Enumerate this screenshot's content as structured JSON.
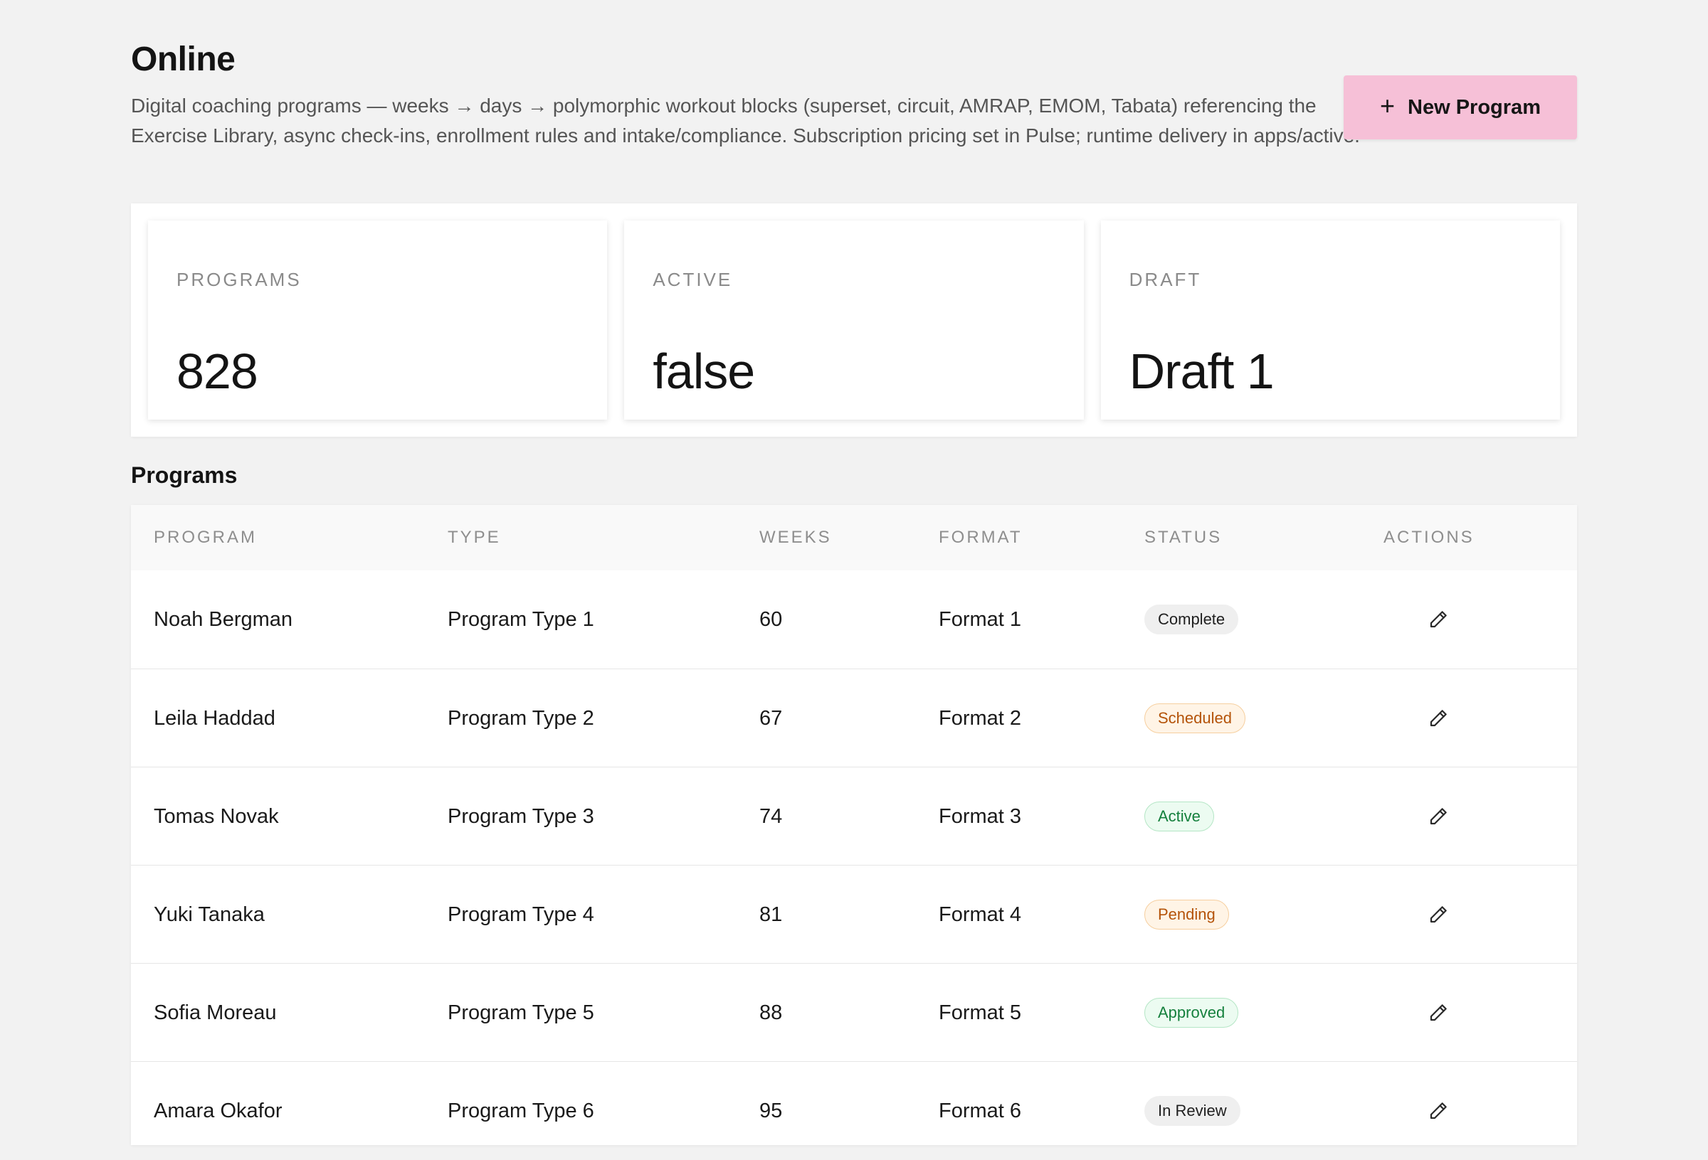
{
  "header": {
    "title": "Online",
    "description": "Digital coaching programs — weeks → days → polymorphic workout blocks (superset, circuit, AMRAP, EMOM, Tabata) referencing the Exercise Library, async check-ins, enrollment rules and intake/compliance. Subscription pricing set in Pulse; runtime delivery in apps/active.",
    "new_button_label": "New Program"
  },
  "stats": [
    {
      "label": "PROGRAMS",
      "value": "828"
    },
    {
      "label": "ACTIVE",
      "value": "false"
    },
    {
      "label": "DRAFT",
      "value": "Draft 1"
    }
  ],
  "programs_section": {
    "title": "Programs",
    "columns": [
      "PROGRAM",
      "TYPE",
      "WEEKS",
      "FORMAT",
      "STATUS",
      "ACTIONS"
    ],
    "rows": [
      {
        "program": "Noah Bergman",
        "type": "Program Type 1",
        "weeks": "60",
        "format": "Format 1",
        "status": "Complete",
        "status_style": "neutral"
      },
      {
        "program": "Leila Haddad",
        "type": "Program Type 2",
        "weeks": "67",
        "format": "Format 2",
        "status": "Scheduled",
        "status_style": "warning"
      },
      {
        "program": "Tomas Novak",
        "type": "Program Type 3",
        "weeks": "74",
        "format": "Format 3",
        "status": "Active",
        "status_style": "success"
      },
      {
        "program": "Yuki Tanaka",
        "type": "Program Type 4",
        "weeks": "81",
        "format": "Format 4",
        "status": "Pending",
        "status_style": "warning"
      },
      {
        "program": "Sofia Moreau",
        "type": "Program Type 5",
        "weeks": "88",
        "format": "Format 5",
        "status": "Approved",
        "status_style": "success"
      },
      {
        "program": "Amara Okafor",
        "type": "Program Type 6",
        "weeks": "95",
        "format": "Format 6",
        "status": "In Review",
        "status_style": "neutral"
      }
    ]
  },
  "colors": {
    "background": "#f2f2f2",
    "primary_button": "#f6c0d7",
    "badge_neutral_bg": "#efefef",
    "badge_neutral_text": "#1f1f1f",
    "badge_warning_bg": "#fff4e6",
    "badge_warning_border": "#f6cf9f",
    "badge_warning_text": "#b45309",
    "badge_success_bg": "#ecfbf1",
    "badge_success_border": "#b4e6c5",
    "badge_success_text": "#15803d"
  },
  "icons": {
    "new_button": "plus-icon",
    "row_action": "pencil-icon"
  }
}
